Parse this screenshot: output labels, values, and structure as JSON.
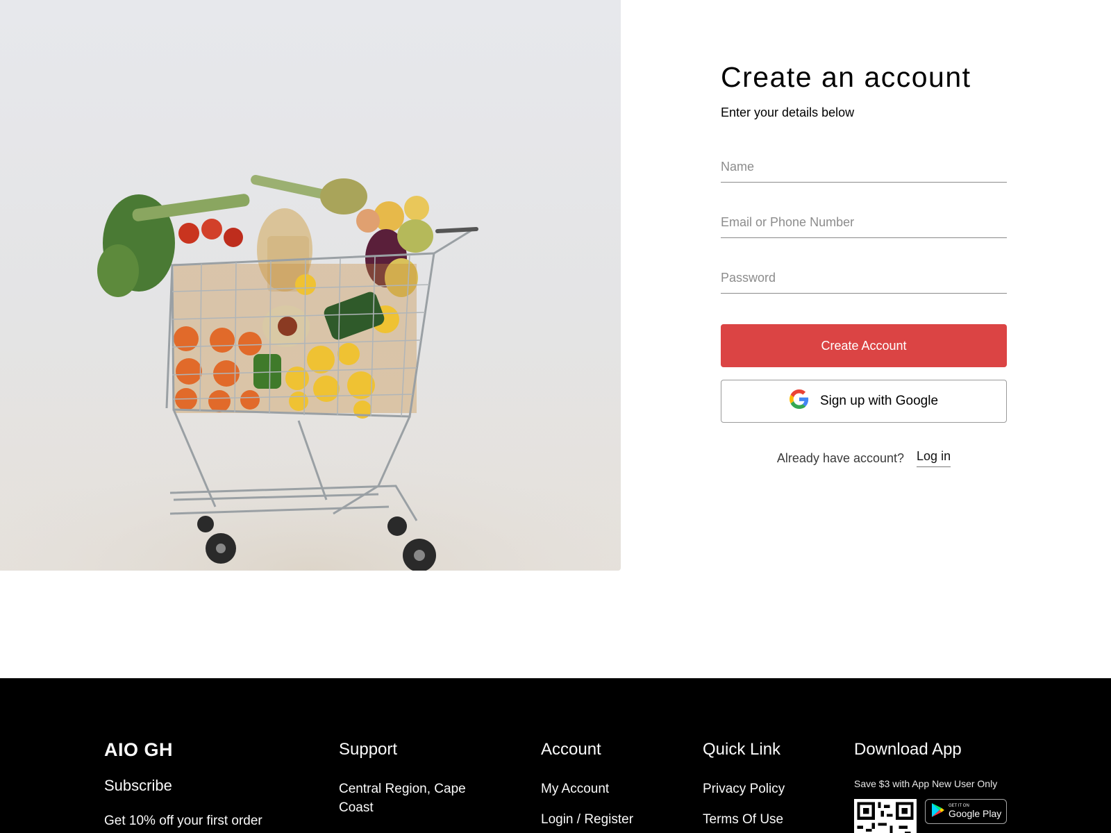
{
  "form": {
    "title": "Create an account",
    "subtitle": "Enter your details below",
    "name_placeholder": "Name",
    "email_placeholder": "Email or Phone Number",
    "password_placeholder": "Password",
    "create_label": "Create Account",
    "google_label": "Sign up with Google",
    "have_account": "Already have account?",
    "login_label": "Log in"
  },
  "colors": {
    "accent": "#db4444",
    "footer_bg": "#000000"
  },
  "hero": {
    "alt": "Shopping cart full of fresh groceries"
  },
  "footer": {
    "brand": "AIO GH",
    "subscribe": "Subscribe",
    "subscribe_text": "Get 10% off your first order",
    "support": {
      "title": "Support",
      "address": "Central Region, Cape Coast"
    },
    "account": {
      "title": "Account",
      "items": [
        "My Account",
        "Login / Register"
      ]
    },
    "quick": {
      "title": "Quick Link",
      "items": [
        "Privacy Policy",
        "Terms Of Use"
      ]
    },
    "download": {
      "title": "Download App",
      "promo": "Save $3 with App New User Only",
      "badge_small": "GET IT ON",
      "badge_big": "Google Play"
    }
  }
}
